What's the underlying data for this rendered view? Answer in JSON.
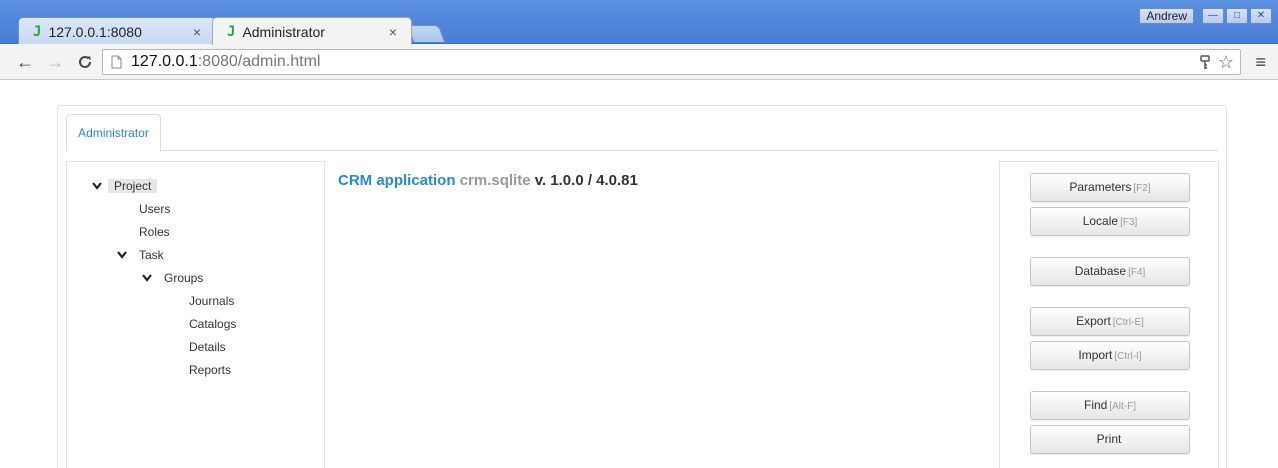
{
  "browser": {
    "tabs": [
      {
        "favicon": "J",
        "title": "127.0.0.1:8080",
        "close": "×"
      },
      {
        "favicon": "J",
        "title": "Administrator",
        "close": "×"
      }
    ],
    "user": "Andrew",
    "window_controls": {
      "minimize": "—",
      "maximize": "□",
      "close": "✕"
    },
    "url_host": "127.0.0.1",
    "url_rest": ":8080/admin.html",
    "icons": {
      "back": "←",
      "forward": "→",
      "reload": "C",
      "page": "🗋",
      "key": "⚲",
      "star": "☆",
      "menu": "≡"
    }
  },
  "page": {
    "tab_label": "Administrator",
    "tree": [
      {
        "label": "Project",
        "expanded": true,
        "chevron": "❯"
      },
      {
        "label": "Users"
      },
      {
        "label": "Roles"
      },
      {
        "label": "Task",
        "expanded": true,
        "chevron": "❯"
      },
      {
        "label": "Groups",
        "expanded": true,
        "chevron": "❯"
      },
      {
        "label": "Journals"
      },
      {
        "label": "Catalogs"
      },
      {
        "label": "Details"
      },
      {
        "label": "Reports"
      }
    ],
    "app": {
      "name": "CRM application",
      "db": "crm.sqlite",
      "version": "v. 1.0.0 / 4.0.81"
    },
    "buttons": [
      {
        "label": "Parameters",
        "shortcut": "[F2]"
      },
      {
        "label": "Locale",
        "shortcut": "[F3]"
      },
      {
        "label": "Database",
        "shortcut": "[F4]"
      },
      {
        "label": "Export",
        "shortcut": "[Ctrl-E]"
      },
      {
        "label": "Import",
        "shortcut": "[Ctrl-I]"
      },
      {
        "label": "Find",
        "shortcut": "[Alt-F]"
      },
      {
        "label": "Print",
        "shortcut": ""
      }
    ]
  },
  "colors": {
    "accent": "#2a8bcc",
    "chrome": "#4a7ed6"
  }
}
